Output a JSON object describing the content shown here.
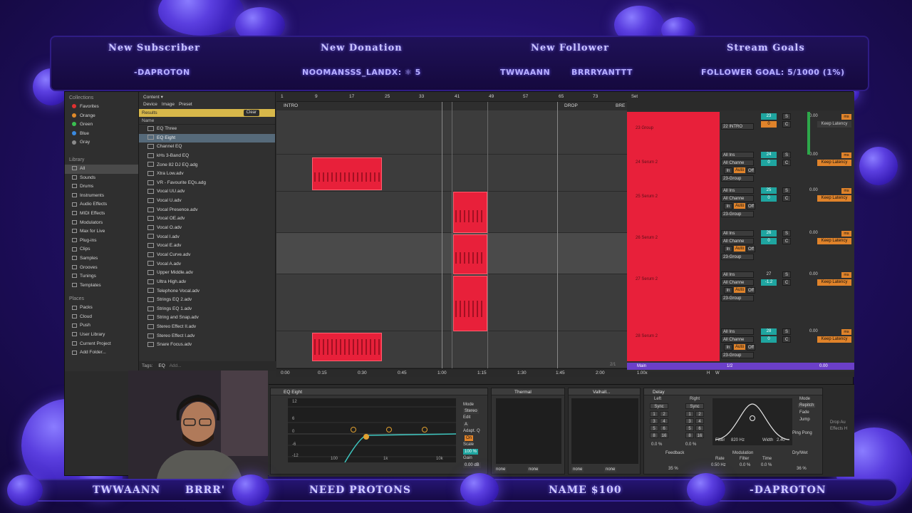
{
  "overlay": {
    "labels": {
      "new_subscriber": "New Subscriber",
      "new_donation": "New Donation",
      "new_follower": "New Follower",
      "stream_goals": "Stream Goals"
    },
    "values": {
      "subscriber": "-DAPROTON",
      "donation": "NOOMANSSS_LANDX: ⚛ 5",
      "follower_1": "TWWAANN",
      "follower_2": "BRRRYANTTT",
      "goal": "FOLLOWER GOAL: 5/1000 (1%)"
    },
    "ticker": {
      "item_1": "TWWAANN",
      "item_2": "BRRR'",
      "item_3": "NEED PROTONS",
      "item_4": "NAME $100",
      "item_5": "-DAPROTON"
    }
  },
  "browser": {
    "collections_header": "Collections",
    "collections": [
      {
        "label": "Favorites",
        "color": "#e03030"
      },
      {
        "label": "Orange",
        "color": "#e08a2a"
      },
      {
        "label": "Green",
        "color": "#3ac050"
      },
      {
        "label": "Blue",
        "color": "#3a8ae0"
      },
      {
        "label": "Gray",
        "color": "#8a8a8a"
      }
    ],
    "library_header": "Library",
    "library": [
      "All",
      "Sounds",
      "Drums",
      "Instruments",
      "Audio Effects",
      "MIDI Effects",
      "Modulators",
      "Max for Live",
      "Plug-ins",
      "Clips",
      "Samples",
      "Grooves",
      "Tunings",
      "Templates"
    ],
    "places_header": "Places",
    "places": [
      "Packs",
      "Cloud",
      "Push",
      "User Library",
      "Current Project",
      "Add Folder..."
    ],
    "content_label": "Content ▾",
    "tabs": [
      "Device",
      "Image",
      "Preset"
    ],
    "results_label": "Results",
    "clear_label": "Clear",
    "name_header": "Name",
    "files": [
      "EQ Three",
      "EQ Eight",
      "Channel EQ",
      "kHs 3-Band EQ",
      "Zone 82 DJ EQ.adg",
      "Xtra Low.adv",
      "VR - Favourite EQs.adg",
      "Vocal UU.adv",
      "Vocal U.adv",
      "Vocal Presence.adv",
      "Vocal OE.adv",
      "Vocal O.adv",
      "Vocal I.adv",
      "Vocal E.adv",
      "Vocal Curve.adv",
      "Vocal A.adv",
      "Upper Middle.adv",
      "Ultra High.adv",
      "Telephone Vocal.adv",
      "Strings EQ 2.adv",
      "Strings EQ 1.adv",
      "String and Snap.adv",
      "Stereo Effect II.adv",
      "Stereo Effect I.adv",
      "Snare Focus.adv"
    ],
    "tags_label": "Tags:",
    "tag_eq": "EQ",
    "tag_add": "Add..."
  },
  "arrangement": {
    "bars": [
      "1",
      "9",
      "17",
      "25",
      "33",
      "41",
      "49",
      "57",
      "65",
      "73"
    ],
    "locators": [
      "INTRO",
      "DROP",
      "BRE"
    ],
    "times": [
      "0:00",
      "0:15",
      "0:30",
      "0:45",
      "1:00",
      "1:15",
      "1:30",
      "1:45",
      "2:00"
    ],
    "page": "2/1"
  },
  "session": {
    "set_label": "Set",
    "tracks": [
      {
        "name": "23 Group",
        "number": "23"
      },
      {
        "name": "24 Serum 2",
        "number": "24"
      },
      {
        "name": "25 Serum 2",
        "number": "25"
      },
      {
        "name": "26 Serum 2",
        "number": "26"
      },
      {
        "name": "27 Serum 2",
        "number": "27"
      },
      {
        "name": "28 Serum 2",
        "number": "28"
      }
    ],
    "input_22": "22 INTRO",
    "all_ins": "All Ins",
    "all_channels": "All Channe",
    "in_label": "In",
    "auto_label": "Auto",
    "off_label": "Off",
    "group_label": "23-Group",
    "zero": "0",
    "c_label": "C",
    "s_label": "S",
    "neg": "-1.2",
    "vol": "0.00",
    "ms": "ms",
    "keep_latency": "Keep Latency",
    "main": "Main",
    "zoom": "1.00x",
    "half": "1/2",
    "h": "H",
    "w": "W"
  },
  "devices": {
    "eq_title": "EQ Eight",
    "eq_db_top": "12",
    "eq_db_mid": "6",
    "eq_db_zero": "0",
    "eq_db_neg6": "-6",
    "eq_db_neg12": "-12",
    "eq_freq_100": "100",
    "eq_freq_1k": "1k",
    "eq_freq_10k": "10k",
    "mode_label": "Mode",
    "stereo": "Stereo",
    "edit": "Edit",
    "edit_a": "A",
    "adapt_q": "Adapt. Q",
    "on": "On",
    "scale": "Scale",
    "scale_val": "100 %",
    "gain": "Gain",
    "gain_val": "0.00 dB",
    "thermal_title": "Thermal",
    "valhalla_title": "Valhall...",
    "none": "none",
    "delay_title": "Delay",
    "left": "Left",
    "right": "Right",
    "sync": "Sync",
    "delay_mode": "Mode",
    "repitch": "Repitch",
    "fade": "Fade",
    "jump": "Jump",
    "ping_pong": "Ping Pong",
    "filter": "Filter",
    "filter_freq": "820 Hz",
    "width": "Width",
    "width_val": "2.40",
    "feedback": "Feedback",
    "feedback_val": "35 %",
    "modulation": "Modulation",
    "rate": "Rate",
    "rate_val": "0.50 Hz",
    "filter_mod": "Filter",
    "filter_mod_val": "0.0 %",
    "time": "Time",
    "time_val": "0.0 %",
    "dry_wet": "Dry/Wet",
    "dry_wet_val": "36 %",
    "drop_audio": "Drop Au",
    "effects_h": "Effects H",
    "pct_zero": "0.0 %"
  }
}
